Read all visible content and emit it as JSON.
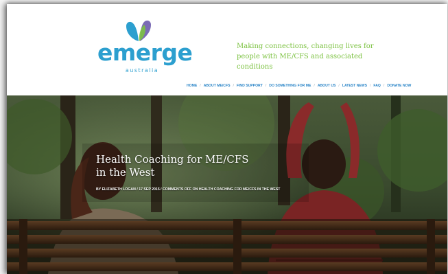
{
  "brand": {
    "name": "emerge",
    "sub": "australia",
    "tagline": "Making connections, changing lives for people with ME/CFS and associated conditions",
    "colors": {
      "blue": "#2c9fcf",
      "green": "#7cc241",
      "purple": "#7b6bb5"
    }
  },
  "nav": {
    "items": [
      {
        "label": "HOME"
      },
      {
        "label": "ABOUT ME/CFS"
      },
      {
        "label": "FIND SUPPORT"
      },
      {
        "label": "DO SOMETHING FOR ME"
      },
      {
        "label": "ABOUT US"
      },
      {
        "label": "LATEST NEWS"
      },
      {
        "label": "FAQ"
      },
      {
        "label": "DONATE NOW"
      }
    ],
    "separator": "/"
  },
  "post": {
    "title": "Health Coaching for ME/CFS in the West",
    "meta": {
      "prefix": "BY",
      "author": "ELIZABETH LOGAN",
      "date": "17 SEP 2015",
      "comments": "COMMENTS OFF",
      "comments_suffix": "ON HEALTH COACHING FOR ME/CFS IN THE WEST",
      "sep": "/"
    }
  }
}
